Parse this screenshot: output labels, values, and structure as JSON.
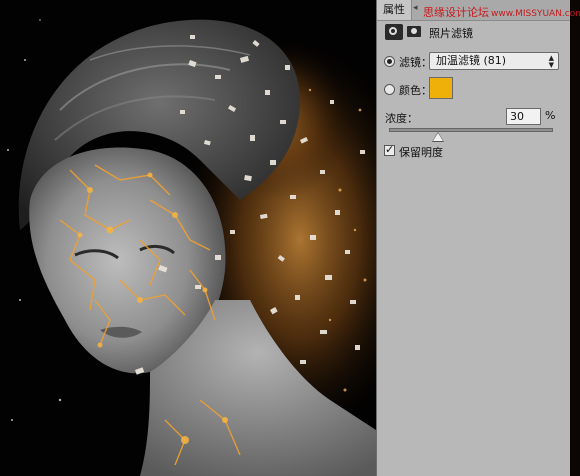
{
  "panel": {
    "tab_label": "属性",
    "tab_arrow": "◂",
    "watermark_text": "思缘设计论坛",
    "watermark_url": "www.MISSYUAN.com",
    "adjustment_type_label": "照片滤镜",
    "filter_label": "滤镜：",
    "filter_selected": "加温滤镜 (81)",
    "color_label": "颜色：",
    "color_swatch_hex": "#efb009",
    "density_label": "浓度：",
    "density_value": "30",
    "density_unit": "%",
    "density_slider_fraction": 0.3,
    "preserve_luminosity_label": "保留明度",
    "preserve_luminosity_checked": true,
    "filter_mode_selected": true,
    "color_mode_selected": false
  },
  "colors": {
    "panel_bg": "#b8b8b8",
    "canvas_bg": "#020202",
    "accent_orange": "#efb009",
    "watermark_red": "#c8181e"
  },
  "icons": {
    "adjustment": "photo-filter-adjustment-icon",
    "mask": "layer-mask-icon",
    "select_arrows": "up-down-arrows-icon",
    "checkmark": "checkmark-icon"
  }
}
